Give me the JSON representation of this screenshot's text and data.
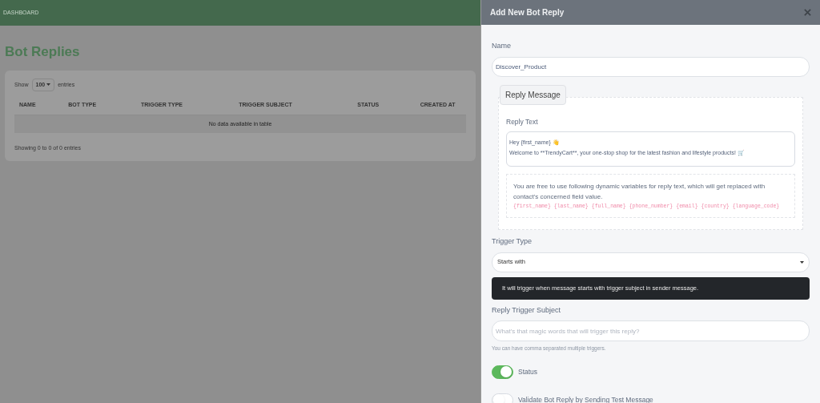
{
  "topbar": {
    "label": "DASHBOARD"
  },
  "page": {
    "title": "Bot Replies",
    "show_label": "Show",
    "page_size": "100",
    "entries_label": "entries",
    "columns": [
      "NAME",
      "BOT TYPE",
      "TRIGGER TYPE",
      "TRIGGER SUBJECT",
      "STATUS",
      "CREATED AT"
    ],
    "empty_message": "No data available in table",
    "footer": "Showing 0 to 0 of 0 entries"
  },
  "panel": {
    "title": "Add New Bot Reply",
    "name_label": "Name",
    "name_value": "Discover_Product",
    "section_legend": "Reply Message",
    "reply_text_label": "Reply Text",
    "reply_text_lines": [
      "Hey {first_name} 👋",
      "Welcome to **TrendyCart**, your one-stop shop for the latest fashion and lifestyle products! 🛒"
    ],
    "variables_hint": "You are free to use following dynamic variables for reply text, which will get replaced with contact's concerned field value.",
    "variables": [
      "{first_name}",
      "{last_name}",
      "{full_name}",
      "{phone_number}",
      "{email}",
      "{country}",
      "{language_code}"
    ],
    "trigger_type_label": "Trigger Type",
    "trigger_type_value": "Starts with",
    "trigger_info": "It will trigger when message starts with trigger subject in sender message.",
    "subject_label": "Reply Trigger Subject",
    "subject_placeholder": "What's that magic words that will trigger this reply?",
    "subject_help": "You can have comma separated multiple triggers.",
    "switches": [
      {
        "label": "Status",
        "on": true
      },
      {
        "label": "Validate Bot Reply by Sending Test Message",
        "on": false
      }
    ]
  }
}
